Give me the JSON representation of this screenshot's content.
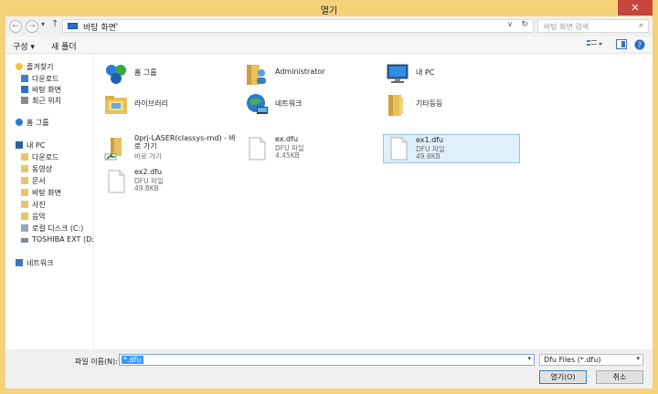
{
  "window": {
    "title": "열기",
    "close_glyph": "✕"
  },
  "address": {
    "back_glyph": "←",
    "forward_glyph": "→",
    "up_glyph": "↑",
    "path": "바탕 화면",
    "chevron": "›",
    "dropdown_glyph": "∨",
    "refresh_glyph": "↻",
    "search_placeholder": "바탕 화면 검색",
    "search_glyph": "⌕"
  },
  "toolbar": {
    "organize": "구성 ▾",
    "new_folder": "새 폴더",
    "help_glyph": "?"
  },
  "nav": {
    "favorites": {
      "label": "즐겨찾기",
      "items": [
        "다운로드",
        "바탕 화면",
        "최근 위치"
      ]
    },
    "homegroup": "홈 그룹",
    "pc": {
      "label": "내 PC",
      "items": [
        "다운로드",
        "동영상",
        "문서",
        "바탕 화면",
        "사진",
        "음악",
        "로컬 디스크 (C:)",
        "TOSHIBA EXT (D:)"
      ]
    },
    "network": "네트워크"
  },
  "tiles": [
    {
      "name": "홈 그룹",
      "icon": "homegroup-icon"
    },
    {
      "name": "Administrator",
      "icon": "user-folder-icon"
    },
    {
      "name": "내 PC",
      "icon": "computer-icon"
    },
    {
      "name": "라이브러리",
      "icon": "library-icon"
    },
    {
      "name": "네트워크",
      "icon": "network-icon"
    },
    {
      "name": "기타등등",
      "icon": "folder-icon"
    },
    {
      "name": "0prj-LASER(classys-rnd) - 바로 가기",
      "type": "바로 가기",
      "icon": "shortcut-icon"
    },
    {
      "name": "ex.dfu",
      "type": "DFU 파일",
      "size": "4.45KB",
      "icon": "file-icon"
    },
    {
      "name": "ex1.dfu",
      "type": "DFU 파일",
      "size": "49.8KB",
      "icon": "file-icon",
      "selected": true
    },
    {
      "name": "ex2.dfu",
      "type": "DFU 파일",
      "size": "49.8KB",
      "icon": "file-icon"
    }
  ],
  "bottom": {
    "filename_label": "파일 이름(N):",
    "filename_value": "*.dfu",
    "filetype_value": "Dfu Files (*.dfu)",
    "open_button": "열기(O)",
    "cancel_button": "취소",
    "dropdown_glyph": "▾"
  },
  "colors": {
    "title_bar": "#f5d27a",
    "close": "#c7463b",
    "selection": "#3399ff",
    "selected_tile_bg": "#dff0fb"
  }
}
